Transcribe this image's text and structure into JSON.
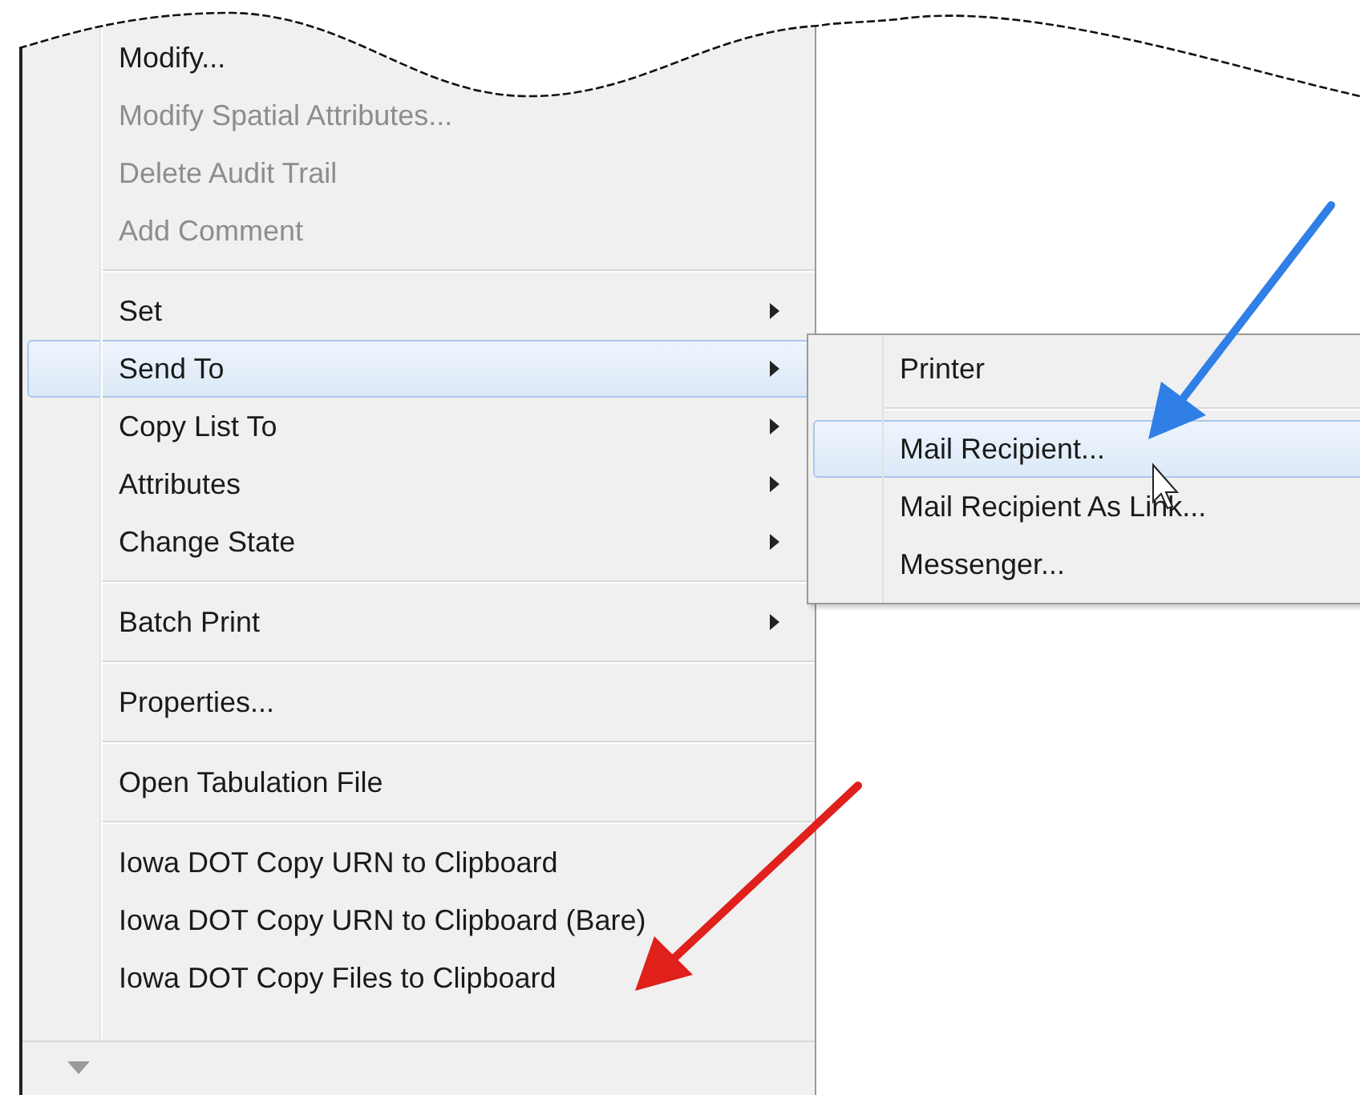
{
  "menu": {
    "items": [
      {
        "kind": "item",
        "label": "Modify...",
        "disabled": false,
        "selected": false,
        "submenu": false
      },
      {
        "kind": "item",
        "label": "Modify Spatial Attributes...",
        "disabled": true,
        "selected": false,
        "submenu": false
      },
      {
        "kind": "item",
        "label": "Delete Audit Trail",
        "disabled": true,
        "selected": false,
        "submenu": false
      },
      {
        "kind": "item",
        "label": "Add Comment",
        "disabled": true,
        "selected": false,
        "submenu": false
      },
      {
        "kind": "separator"
      },
      {
        "kind": "item",
        "label": "Set",
        "disabled": false,
        "selected": false,
        "submenu": true
      },
      {
        "kind": "item",
        "label": "Send To",
        "disabled": false,
        "selected": true,
        "submenu": true
      },
      {
        "kind": "item",
        "label": "Copy List To",
        "disabled": false,
        "selected": false,
        "submenu": true
      },
      {
        "kind": "item",
        "label": "Attributes",
        "disabled": false,
        "selected": false,
        "submenu": true
      },
      {
        "kind": "item",
        "label": "Change State",
        "disabled": false,
        "selected": false,
        "submenu": true
      },
      {
        "kind": "separator"
      },
      {
        "kind": "item",
        "label": "Batch Print",
        "disabled": false,
        "selected": false,
        "submenu": true
      },
      {
        "kind": "separator"
      },
      {
        "kind": "item",
        "label": "Properties...",
        "disabled": false,
        "selected": false,
        "submenu": false
      },
      {
        "kind": "separator"
      },
      {
        "kind": "item",
        "label": "Open Tabulation File",
        "disabled": false,
        "selected": false,
        "submenu": false
      },
      {
        "kind": "separator"
      },
      {
        "kind": "item",
        "label": "Iowa DOT Copy URN to Clipboard",
        "disabled": false,
        "selected": false,
        "submenu": false
      },
      {
        "kind": "item",
        "label": "Iowa DOT Copy URN to Clipboard (Bare)",
        "disabled": false,
        "selected": false,
        "submenu": false
      },
      {
        "kind": "item",
        "label": "Iowa DOT Copy Files to Clipboard",
        "disabled": false,
        "selected": false,
        "submenu": false
      }
    ]
  },
  "submenu": {
    "items": [
      {
        "kind": "item",
        "label": "Printer",
        "selected": false
      },
      {
        "kind": "separator"
      },
      {
        "kind": "item",
        "label": "Mail Recipient...",
        "selected": true
      },
      {
        "kind": "item",
        "label": "Mail Recipient As Link...",
        "selected": false
      },
      {
        "kind": "item",
        "label": "Messenger...",
        "selected": false
      }
    ]
  }
}
